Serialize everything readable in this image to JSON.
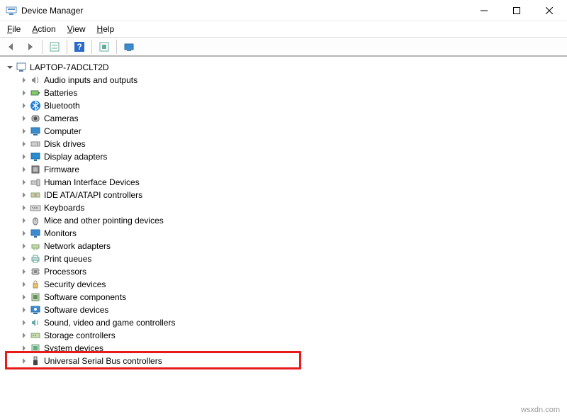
{
  "window": {
    "title": "Device Manager"
  },
  "menu": {
    "file": "File",
    "action": "Action",
    "view": "View",
    "help": "Help"
  },
  "root": {
    "name": "LAPTOP-7ADCLT2D"
  },
  "devices": [
    {
      "id": "audio",
      "label": "Audio inputs and outputs",
      "icon": "speaker"
    },
    {
      "id": "batteries",
      "label": "Batteries",
      "icon": "battery"
    },
    {
      "id": "bluetooth",
      "label": "Bluetooth",
      "icon": "bluetooth"
    },
    {
      "id": "cameras",
      "label": "Cameras",
      "icon": "camera"
    },
    {
      "id": "computer",
      "label": "Computer",
      "icon": "computer"
    },
    {
      "id": "disk",
      "label": "Disk drives",
      "icon": "disk"
    },
    {
      "id": "display",
      "label": "Display adapters",
      "icon": "display"
    },
    {
      "id": "firmware",
      "label": "Firmware",
      "icon": "firmware"
    },
    {
      "id": "hid",
      "label": "Human Interface Devices",
      "icon": "hid"
    },
    {
      "id": "ide",
      "label": "IDE ATA/ATAPI controllers",
      "icon": "ide"
    },
    {
      "id": "keyboards",
      "label": "Keyboards",
      "icon": "keyboard"
    },
    {
      "id": "mice",
      "label": "Mice and other pointing devices",
      "icon": "mouse"
    },
    {
      "id": "monitors",
      "label": "Monitors",
      "icon": "monitor"
    },
    {
      "id": "network",
      "label": "Network adapters",
      "icon": "network"
    },
    {
      "id": "print",
      "label": "Print queues",
      "icon": "printer"
    },
    {
      "id": "processors",
      "label": "Processors",
      "icon": "cpu"
    },
    {
      "id": "security",
      "label": "Security devices",
      "icon": "security"
    },
    {
      "id": "swcomp",
      "label": "Software components",
      "icon": "swcomp"
    },
    {
      "id": "swdev",
      "label": "Software devices",
      "icon": "swdev"
    },
    {
      "id": "sound",
      "label": "Sound, video and game controllers",
      "icon": "sound"
    },
    {
      "id": "storage",
      "label": "Storage controllers",
      "icon": "storage"
    },
    {
      "id": "system",
      "label": "System devices",
      "icon": "system"
    },
    {
      "id": "usb",
      "label": "Universal Serial Bus controllers",
      "icon": "usb",
      "highlighted": true
    }
  ],
  "watermark": "wsxdn.com"
}
